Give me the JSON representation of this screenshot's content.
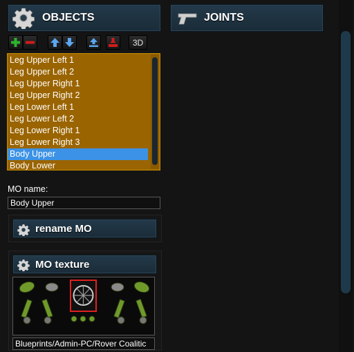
{
  "objects_panel": {
    "title": "OBJECTS",
    "icon": "gear-icon",
    "toolbar": {
      "add": "plus-icon",
      "remove": "minus-icon",
      "move_up": "arrow-up-icon",
      "move_down": "arrow-down-icon",
      "export": "export-icon",
      "import": "import-icon",
      "view3d_label": "3D"
    },
    "items": [
      "Leg Upper Left 1",
      "Leg Upper Left 2",
      "Leg Upper Right 1",
      "Leg Upper Right 2",
      "Leg Lower Left 1",
      "Leg Lower Left 2",
      "Leg Lower Right 1",
      "Leg Lower Right 3",
      "Body Upper",
      "Body Lower"
    ],
    "selected_item": "Body Upper",
    "mo_name_label": "MO name:",
    "mo_name_value": "Body Upper",
    "rename_title": "rename MO",
    "texture_title": "MO texture",
    "texture_path": "Blueprints/Admin-PC/Rover Coalitic"
  },
  "joints_panel": {
    "title": "JOINTS",
    "icon": "joint-gun-icon"
  },
  "colors": {
    "list_bg": "#9a6400",
    "list_border": "#c88e00",
    "selection": "#3c92e6",
    "header_bg": "#1f3442"
  }
}
